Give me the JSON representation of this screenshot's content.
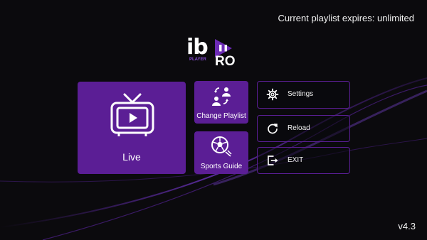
{
  "header": {
    "expiry_text": "Current playlist expires: unlimited"
  },
  "logo": {
    "main": "ib",
    "pro": "RO",
    "sub": "PLAYER"
  },
  "tiles": {
    "live": {
      "label": "Live",
      "icon": "tv-icon"
    },
    "change_playlist": {
      "label": "Change Playlist",
      "icon": "users-swap-icon"
    },
    "sports_guide": {
      "label": "Sports Guide",
      "icon": "soccer-ball-icon"
    }
  },
  "menu": {
    "settings": {
      "label": "Settings",
      "icon": "gear-icon"
    },
    "reload": {
      "label": "Reload",
      "icon": "reload-icon"
    },
    "exit": {
      "label": "EXIT",
      "icon": "exit-icon"
    }
  },
  "footer": {
    "version": "v4.3"
  },
  "colors": {
    "accent": "#5b1e95",
    "background": "#0b0a0d"
  }
}
